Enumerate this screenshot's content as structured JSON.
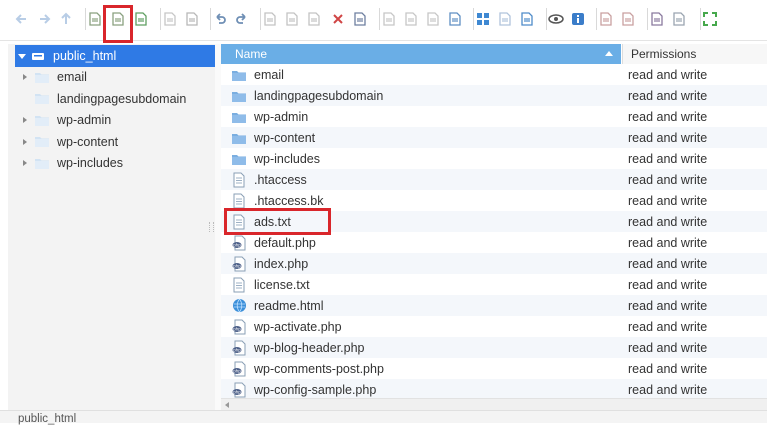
{
  "toolbar": {
    "buttons": [
      "back-icon",
      "forward-icon",
      "up-icon",
      "reload-icon",
      "new-file-icon",
      "new-folder-icon",
      "open-icon",
      "save-icon",
      "undo-icon",
      "redo-icon",
      "copy-icon",
      "cut-icon",
      "paste-icon",
      "delete-icon",
      "restore-icon",
      "duplicate-icon",
      "rename-icon",
      "edit-icon",
      "resize-icon",
      "grid-view-icon",
      "list-view-icon",
      "select-all-icon",
      "view-icon",
      "info-icon",
      "extract-icon",
      "archive-icon",
      "search-icon",
      "settings-icon",
      "fullscreen-icon"
    ],
    "highlighted": "new-file-icon"
  },
  "tree": {
    "root_label": "public_html",
    "items": [
      {
        "label": "email",
        "expandable": true
      },
      {
        "label": "landingpagesubdomain",
        "expandable": false
      },
      {
        "label": "wp-admin",
        "expandable": true
      },
      {
        "label": "wp-content",
        "expandable": true
      },
      {
        "label": "wp-includes",
        "expandable": true
      }
    ]
  },
  "filelist": {
    "header_name": "Name",
    "header_permissions": "Permissions",
    "rows": [
      {
        "name": "email",
        "type": "folder",
        "perm": "read and write"
      },
      {
        "name": "landingpagesubdomain",
        "type": "folder",
        "perm": "read and write"
      },
      {
        "name": "wp-admin",
        "type": "folder",
        "perm": "read and write"
      },
      {
        "name": "wp-content",
        "type": "folder",
        "perm": "read and write"
      },
      {
        "name": "wp-includes",
        "type": "folder",
        "perm": "read and write"
      },
      {
        "name": ".htaccess",
        "type": "text",
        "perm": "read and write"
      },
      {
        "name": ".htaccess.bk",
        "type": "text",
        "perm": "read and write"
      },
      {
        "name": "ads.txt",
        "type": "text",
        "perm": "read and write"
      },
      {
        "name": "default.php",
        "type": "php",
        "perm": "read and write"
      },
      {
        "name": "index.php",
        "type": "php",
        "perm": "read and write"
      },
      {
        "name": "license.txt",
        "type": "text",
        "perm": "read and write"
      },
      {
        "name": "readme.html",
        "type": "html",
        "perm": "read and write"
      },
      {
        "name": "wp-activate.php",
        "type": "php",
        "perm": "read and write"
      },
      {
        "name": "wp-blog-header.php",
        "type": "php",
        "perm": "read and write"
      },
      {
        "name": "wp-comments-post.php",
        "type": "php",
        "perm": "read and write"
      },
      {
        "name": "wp-config-sample.php",
        "type": "php",
        "perm": "read and write"
      }
    ],
    "highlighted_row": "ads.txt"
  },
  "statusbar": {
    "path": "public_html"
  },
  "colors": {
    "selection": "#2f7ae5",
    "header": "#6aaee6",
    "highlight": "#d9262b",
    "folder": "#7aaee0"
  }
}
